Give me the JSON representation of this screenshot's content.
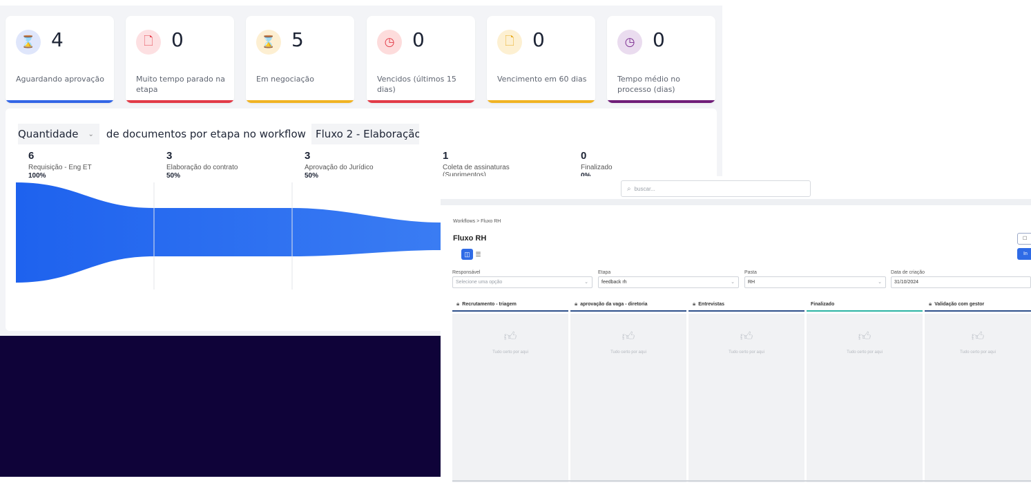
{
  "dashboard": {
    "cards": [
      {
        "value": "4",
        "label": "Aguardando aprovação",
        "icon": "hourglass-icon",
        "glyph": "⌛",
        "icon_bg": "#dfe6fb",
        "icon_color": "#4a6ee0",
        "accent": "#3366e6"
      },
      {
        "value": "0",
        "label": "Muito tempo parado na etapa",
        "icon": "document-icon",
        "glyph": "🗋",
        "icon_bg": "#fde0e2",
        "icon_color": "#e23b48",
        "accent": "#e23b48"
      },
      {
        "value": "5",
        "label": "Em negociação",
        "icon": "hourglass-icon",
        "glyph": "⌛",
        "icon_bg": "#fdefd2",
        "icon_color": "#e6a817",
        "accent": "#f0b323"
      },
      {
        "value": "0",
        "label": "Vencidos (últimos 15 dias)",
        "icon": "clock-icon",
        "glyph": "◷",
        "icon_bg": "#fddcdc",
        "icon_color": "#e23b48",
        "accent": "#e23b48"
      },
      {
        "value": "0",
        "label": "Vencimento em 60 dias",
        "icon": "document-icon",
        "glyph": "🗋",
        "icon_bg": "#fdf0d2",
        "icon_color": "#e6a817",
        "accent": "#f0b323"
      },
      {
        "value": "0",
        "label": "Tempo médio no processo (dias)",
        "icon": "clock-icon",
        "glyph": "◷",
        "icon_bg": "#eadcef",
        "icon_color": "#7a2a8f",
        "accent": "#6f1d78"
      }
    ],
    "query": {
      "metric": "Quantidade",
      "text": "de documentos por etapa no workflow",
      "workflow": "Fluxo 2 - Elaboração"
    },
    "stages": [
      {
        "value": "6",
        "name": "Requisição - Eng ET",
        "percent": "100%"
      },
      {
        "value": "3",
        "name": "Elaboração do contrato",
        "percent": "50%"
      },
      {
        "value": "3",
        "name": "Aprovação do Jurídico",
        "percent": "50%"
      },
      {
        "value": "1",
        "name": "Coleta de assinaturas (Suprimentos)",
        "percent": ""
      },
      {
        "value": "0",
        "name": "Finalizado",
        "percent": "0%"
      }
    ],
    "funnel_color": "#2b6cf0"
  },
  "workflow_screen": {
    "search_placeholder": "buscar...",
    "breadcrumb": "Workflows > Fluxo RH",
    "title": "Fluxo RH",
    "button_partial_1": "☐",
    "button_partial_2": "In",
    "filters": [
      {
        "label": "Responsável",
        "value": "Selecione uma opção",
        "placeholder": true
      },
      {
        "label": "Etapa",
        "value": "feedback rh",
        "placeholder": false
      },
      {
        "label": "Pasta",
        "value": "RH",
        "placeholder": false
      },
      {
        "label": "Data de criação",
        "value": "31/10/2024",
        "placeholder": false
      }
    ],
    "columns": [
      {
        "title": "Recrutamento - triagem",
        "locked": true,
        "accent": "#2d4f8a",
        "empty_text": "Tudo certo por aqui"
      },
      {
        "title": "aprovação da vaga - diretoria",
        "locked": true,
        "accent": "#2d4f8a",
        "empty_text": "Tudo certo por aqui"
      },
      {
        "title": "Entrevistas",
        "locked": true,
        "accent": "#2d4f8a",
        "empty_text": "Tudo certo por aqui"
      },
      {
        "title": "Finalizado",
        "locked": false,
        "accent": "#2bb3a3",
        "empty_text": "Tudo certo por aqui"
      },
      {
        "title": "Validação com gestor",
        "locked": true,
        "accent": "#2d4f8a",
        "empty_text": "Tudo certo por aqui"
      }
    ]
  }
}
